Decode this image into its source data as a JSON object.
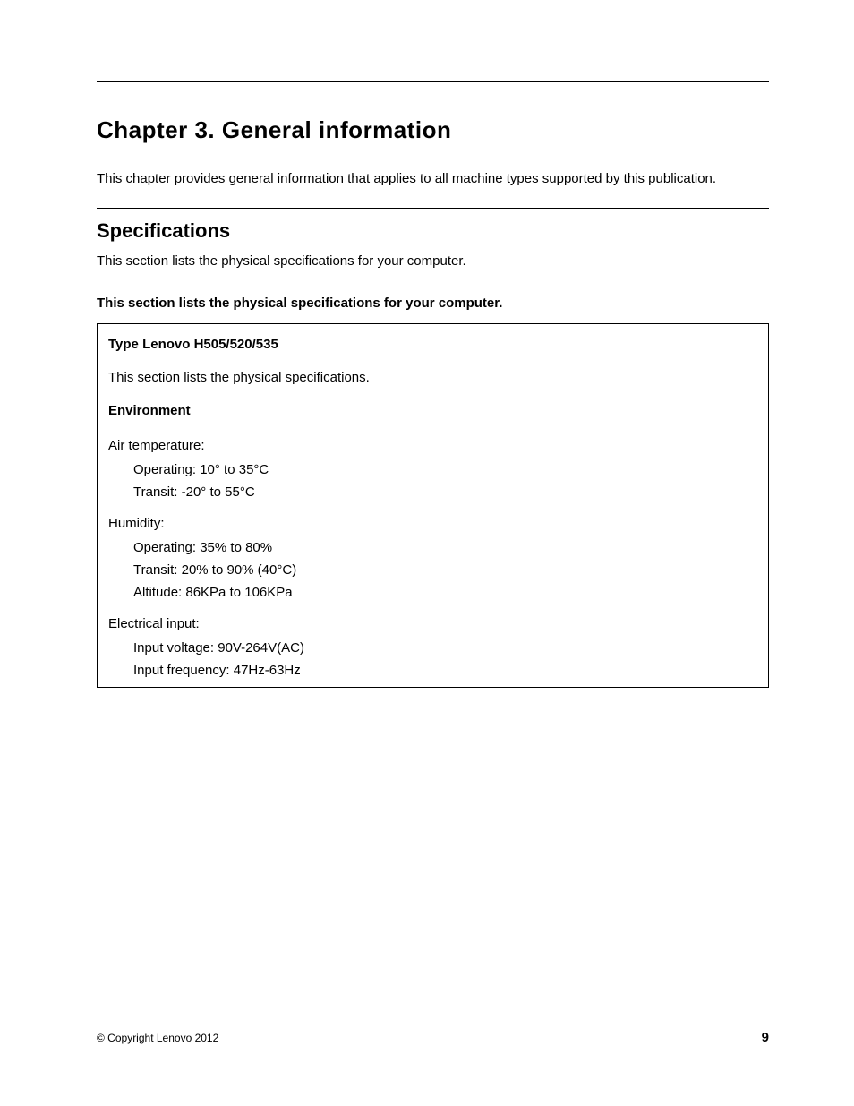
{
  "chapter": {
    "title": "Chapter 3.  General information",
    "intro": "This chapter provides general information that applies to all machine types supported by this publication."
  },
  "section": {
    "heading": "Specifications",
    "intro": "This section lists the physical specifications for your computer.",
    "subheading": "This section lists the physical specifications for your computer."
  },
  "specbox": {
    "type_label": "Type Lenovo H505/520/535",
    "note": "This section lists the physical specifications.",
    "env_heading": "Environment",
    "groups": {
      "air_temp": {
        "label": "Air temperature:",
        "operating": "Operating: 10° to 35°C",
        "transit": "Transit: -20° to 55°C"
      },
      "humidity": {
        "label": "Humidity:",
        "operating": "Operating: 35% to 80%",
        "transit": "Transit: 20% to 90% (40°C)",
        "altitude": "Altitude: 86KPa to 106KPa"
      },
      "electrical": {
        "label": "Electrical input:",
        "voltage": "Input voltage: 90V-264V(AC)",
        "frequency": "Input frequency: 47Hz-63Hz"
      }
    }
  },
  "footer": {
    "copyright": "© Copyright Lenovo 2012",
    "page": "9"
  }
}
